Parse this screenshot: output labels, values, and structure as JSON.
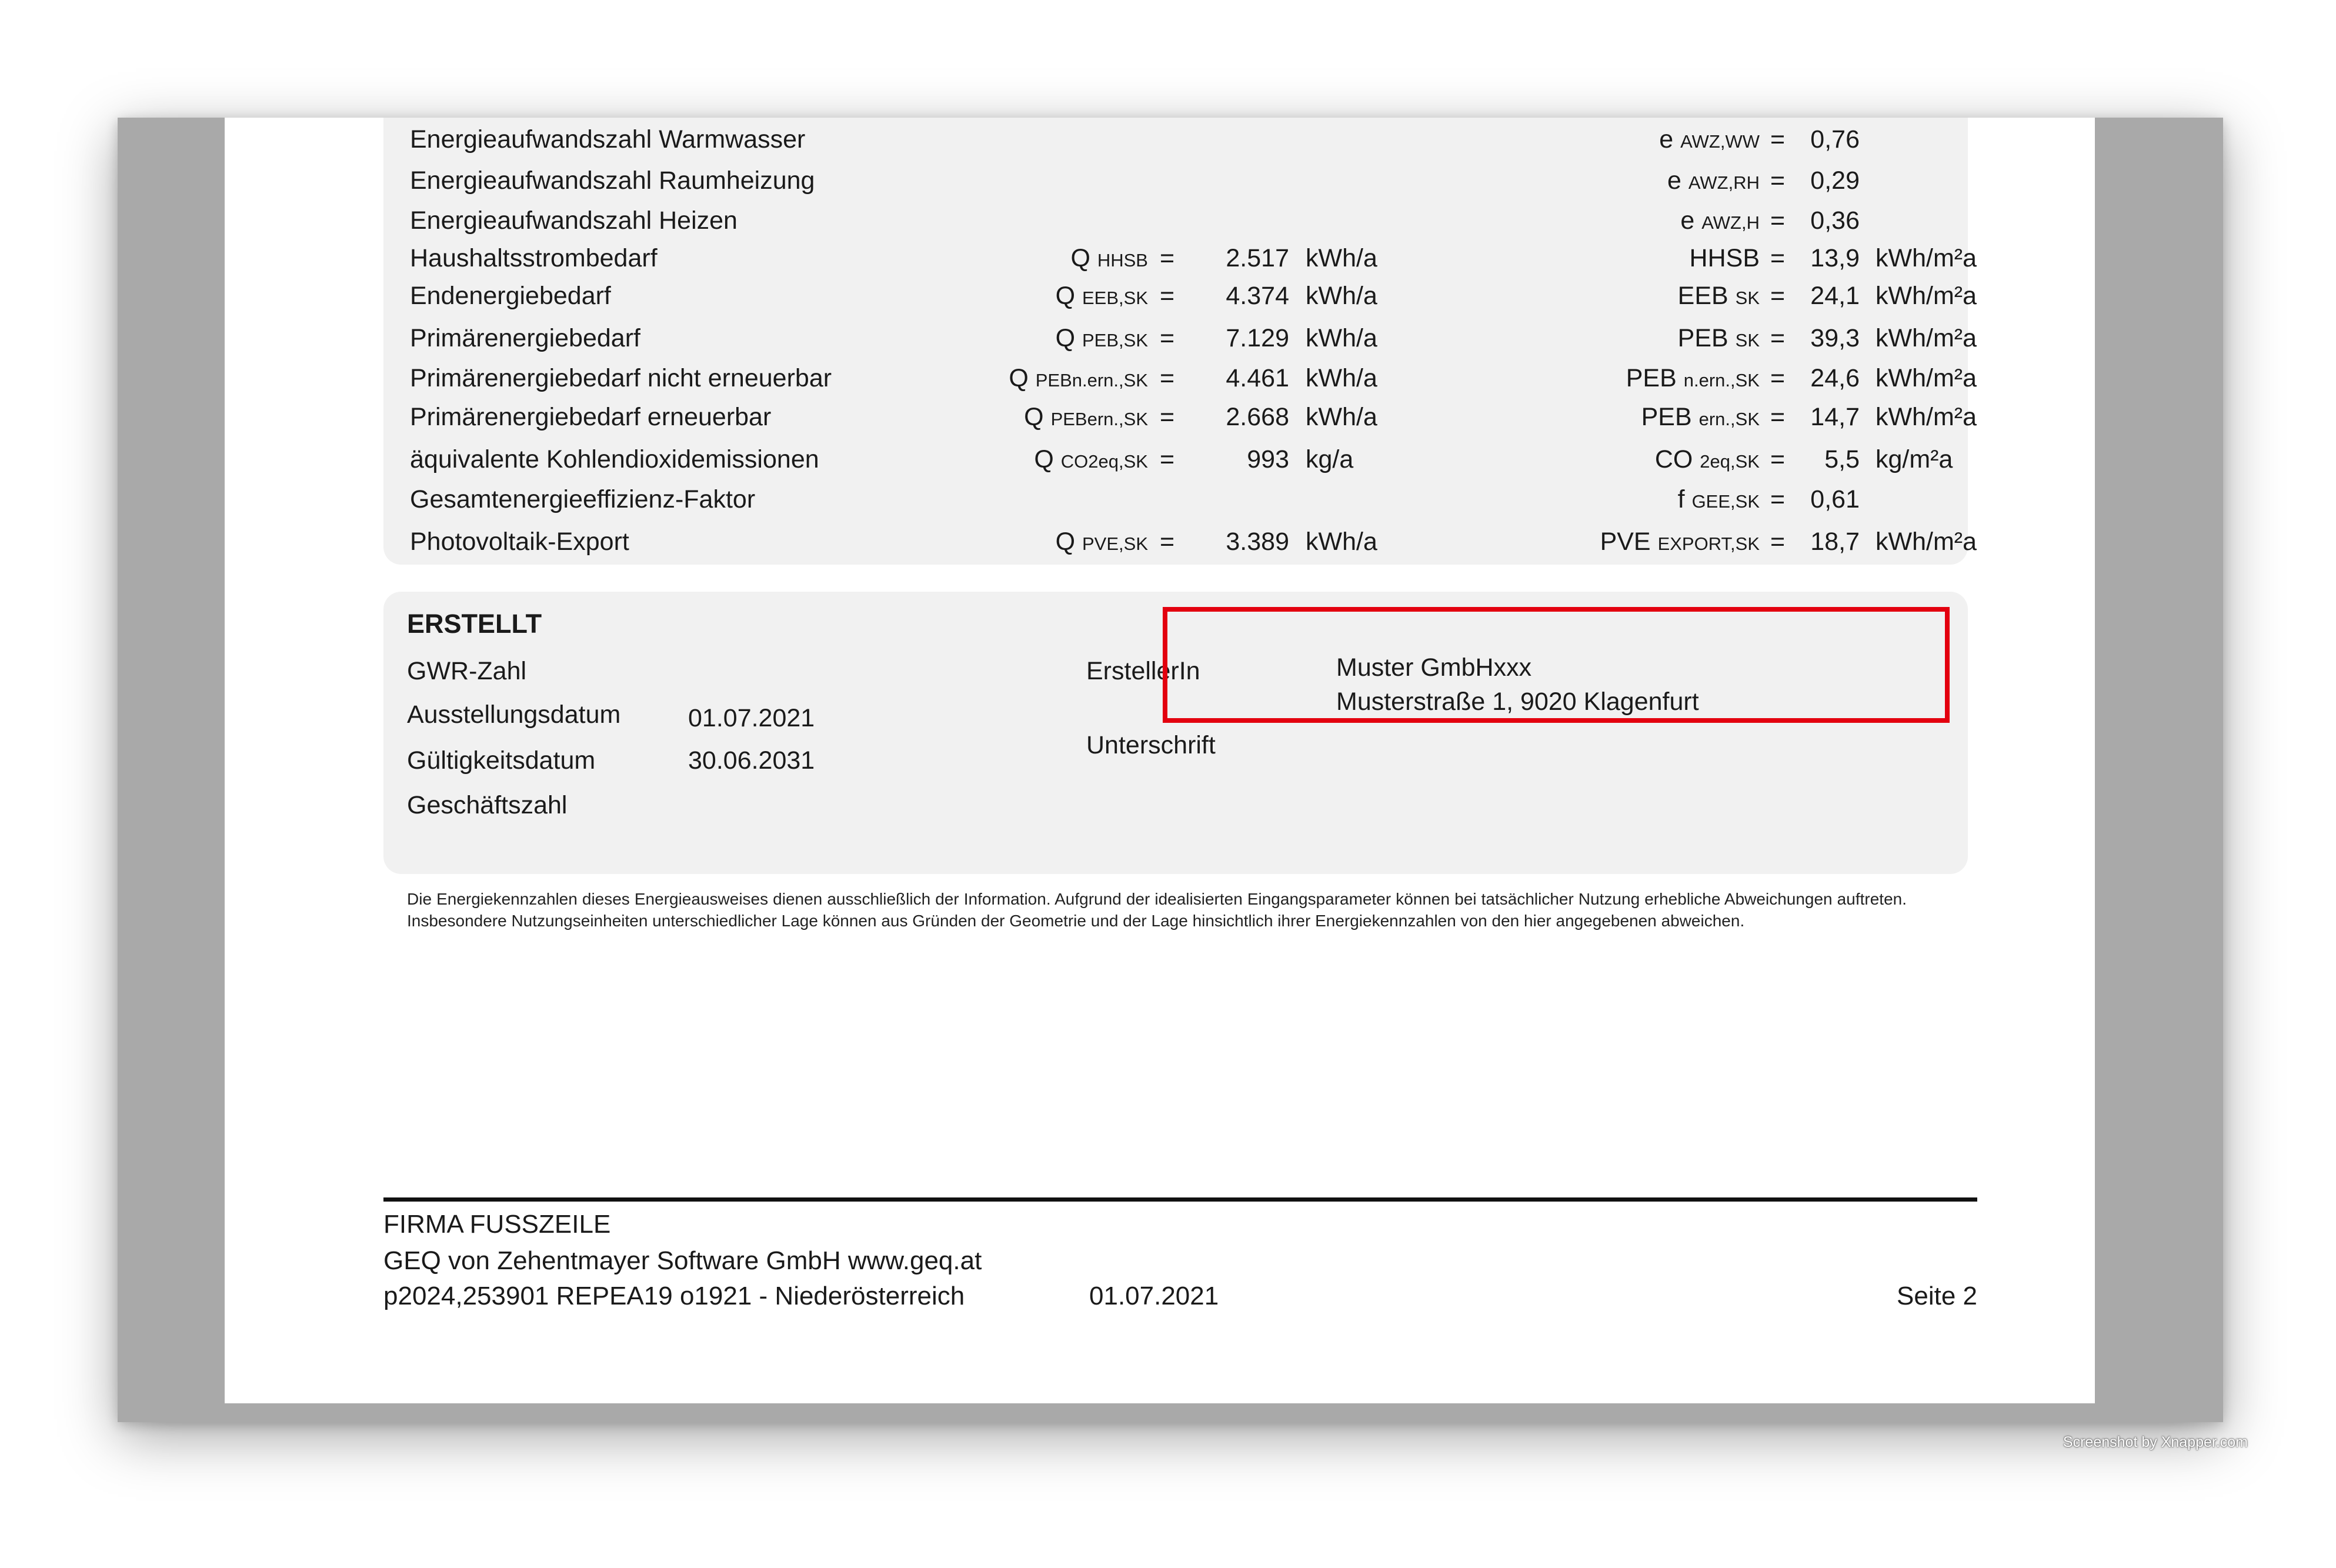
{
  "rows": [
    {
      "label": "Energieaufwandszahl Warmwasser",
      "lsym": "",
      "lsub": "",
      "lval": "",
      "lunit": "",
      "rsym": "e",
      "rsub": "AWZ,WW",
      "rval": "0,76",
      "runit": ""
    },
    {
      "label": "Energieaufwandszahl Raumheizung",
      "lsym": "",
      "lsub": "",
      "lval": "",
      "lunit": "",
      "rsym": "e",
      "rsub": "AWZ,RH",
      "rval": "0,29",
      "runit": ""
    },
    {
      "label": "Energieaufwandszahl Heizen",
      "lsym": "",
      "lsub": "",
      "lval": "",
      "lunit": "",
      "rsym": "e",
      "rsub": "AWZ,H",
      "rval": "0,36",
      "runit": ""
    },
    {
      "label": "Haushaltsstrombedarf",
      "lsym": "Q",
      "lsub": "HHSB",
      "lval": "2.517",
      "lunit": "kWh/a",
      "rsym": "HHSB",
      "rsub": "",
      "rval": "13,9",
      "runit": "kWh/m²a"
    },
    {
      "label": "Endenergiebedarf",
      "lsym": "Q",
      "lsub": "EEB,SK",
      "lval": "4.374",
      "lunit": "kWh/a",
      "rsym": "EEB",
      "rsub": "SK",
      "rval": "24,1",
      "runit": "kWh/m²a"
    },
    {
      "label": "Primärenergiebedarf",
      "lsym": "Q",
      "lsub": "PEB,SK",
      "lval": "7.129",
      "lunit": "kWh/a",
      "rsym": "PEB",
      "rsub": "SK",
      "rval": "39,3",
      "runit": "kWh/m²a"
    },
    {
      "label": "Primärenergiebedarf nicht erneuerbar",
      "lsym": "Q",
      "lsub": "PEBn.ern.,SK",
      "lval": "4.461",
      "lunit": "kWh/a",
      "rsym": "PEB",
      "rsub": "n.ern.,SK",
      "rval": "24,6",
      "runit": "kWh/m²a"
    },
    {
      "label": "Primärenergiebedarf erneuerbar",
      "lsym": "Q",
      "lsub": "PEBern.,SK",
      "lval": "2.668",
      "lunit": "kWh/a",
      "rsym": "PEB",
      "rsub": "ern.,SK",
      "rval": "14,7",
      "runit": "kWh/m²a"
    },
    {
      "label": "äquivalente Kohlendioxidemissionen",
      "lsym": "Q",
      "lsub": "CO2eq,SK",
      "lval": "993",
      "lunit": "kg/a",
      "rsym": "CO",
      "rsub": "2eq,SK",
      "rval": "5,5",
      "runit": "kg/m²a"
    },
    {
      "label": "Gesamtenergieeffizienz-Faktor",
      "lsym": "",
      "lsub": "",
      "lval": "",
      "lunit": "",
      "rsym": "f",
      "rsub": "GEE,SK",
      "rval": "0,61",
      "runit": ""
    },
    {
      "label": "Photovoltaik-Export",
      "lsym": "Q",
      "lsub": "PVE,SK",
      "lval": "3.389",
      "lunit": "kWh/a",
      "rsym": "PVE",
      "rsub": "EXPORT,SK",
      "rval": "18,7",
      "runit": "kWh/m²a"
    }
  ],
  "equals": "=",
  "erstellt": {
    "heading": "ERSTELLT",
    "gwr_label": "GWR-Zahl",
    "ausstellung_label": "Ausstellungsdatum",
    "ausstellung_value": "01.07.2021",
    "gueltigkeit_label": "Gültigkeitsdatum",
    "gueltigkeit_value": "30.06.2031",
    "geschaeftszahl_label": "Geschäftszahl",
    "ersteller_label": "ErstellerIn",
    "ersteller_name": "Muster GmbHxxx",
    "ersteller_address": "Musterstraße 1, 9020 Klagenfurt",
    "unterschrift_label": "Unterschrift"
  },
  "disclaimer": "Die Energiekennzahlen dieses Energieausweises dienen ausschließlich der Information. Aufgrund der idealisierten Eingangsparameter können bei tatsächlicher Nutzung erhebliche Abweichungen auftreten. Insbesondere Nutzungseinheiten unterschiedlicher Lage können aus Gründen der Geometrie und der Lage hinsichtlich ihrer Energiekennzahlen von den hier angegebenen abweichen.",
  "footer": {
    "title": "FIRMA FUSSZEILE",
    "line1": "GEQ von Zehentmayer Software GmbH www.geq.at",
    "line2": "p2024,253901 REPEA19 o1921 - Niederösterreich",
    "date": "01.07.2021",
    "page": "Seite 2"
  },
  "screenshot_credit": "Screenshot by Xnapper.com",
  "colors": {
    "highlight": "#e3000f",
    "panel": "#f1f1f1",
    "viewer": "#a9a9a9"
  }
}
